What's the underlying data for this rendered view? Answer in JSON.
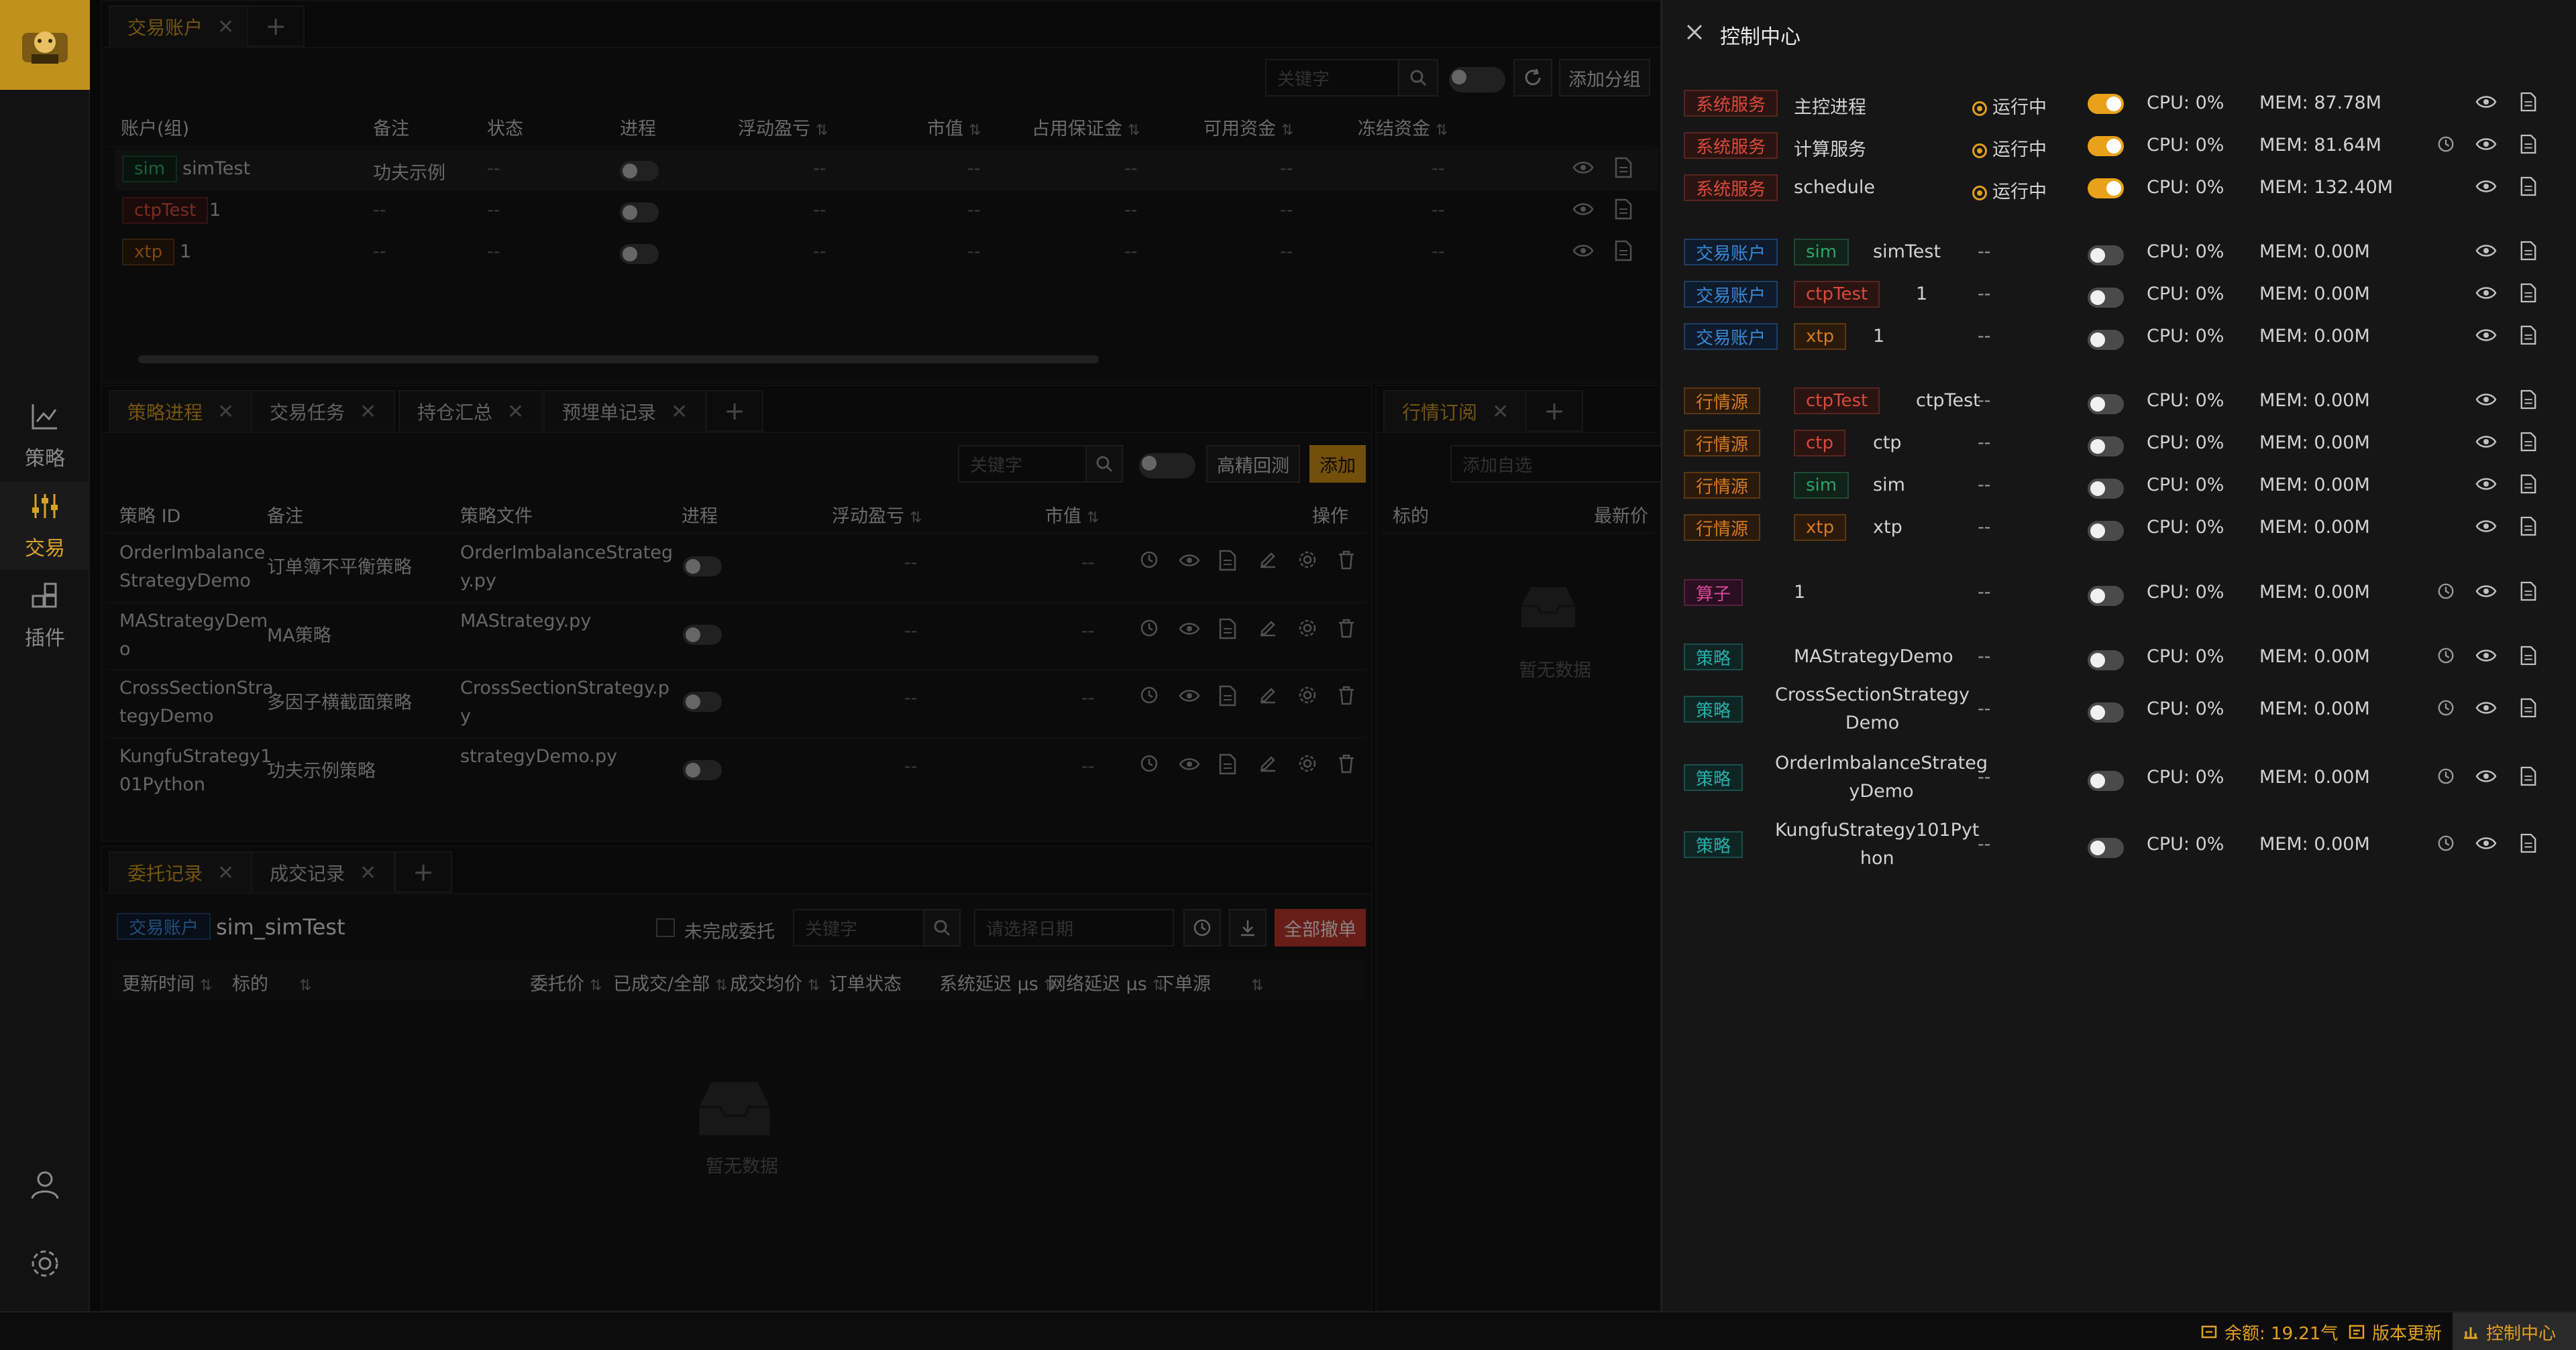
{
  "nav": {
    "items": [
      {
        "label": "策略",
        "icon": "chart-icon"
      },
      {
        "label": "交易",
        "icon": "sliders-icon"
      },
      {
        "label": "插件",
        "icon": "plugin-icon"
      }
    ]
  },
  "accounts": {
    "tabs": [
      {
        "label": "交易账户"
      }
    ],
    "search_placeholder": "关键字",
    "add_group_label": "添加分组",
    "headers": [
      "账户(组)",
      "备注",
      "状态",
      "进程",
      "浮动盈亏",
      "市值",
      "占用保证金",
      "可用资金",
      "冻结资金"
    ],
    "rows": [
      {
        "tag": "sim",
        "name": "simTest",
        "note": "功夫示例",
        "status": "--",
        "pnl": "--",
        "mv": "--",
        "margin": "--",
        "avail": "--",
        "frozen": "--"
      },
      {
        "tag": "ctpTest",
        "name": "1",
        "note": "--",
        "status": "--",
        "pnl": "--",
        "mv": "--",
        "margin": "--",
        "avail": "--",
        "frozen": "--"
      },
      {
        "tag": "xtp",
        "name": "1",
        "note": "--",
        "status": "--",
        "pnl": "--",
        "mv": "--",
        "margin": "--",
        "avail": "--",
        "frozen": "--"
      }
    ]
  },
  "strategy": {
    "tabs": [
      {
        "label": "策略进程"
      },
      {
        "label": "交易任务"
      },
      {
        "label": "持仓汇总"
      },
      {
        "label": "预埋单记录"
      }
    ],
    "search_placeholder": "关键字",
    "backtest_label": "高精回测",
    "add_label": "添加",
    "headers": [
      "策略 ID",
      "备注",
      "策略文件",
      "进程",
      "浮动盈亏",
      "市值",
      "操作"
    ],
    "rows": [
      {
        "id1": "OrderImbalance",
        "id2": "StrategyDemo",
        "note": "订单簿不平衡策略",
        "file1": "OrderImbalanceStrateg",
        "file2": "y.py",
        "pnl": "--",
        "mv": "--"
      },
      {
        "id1": "MAStrategyDem",
        "id2": "o",
        "note": "MA策略",
        "file1": "MAStrategy.py",
        "file2": "",
        "pnl": "--",
        "mv": "--"
      },
      {
        "id1": "CrossSectionStra",
        "id2": "tegyDemo",
        "note": "多因子横截面策略",
        "file1": "CrossSectionStrategy.p",
        "file2": "y",
        "pnl": "--",
        "mv": "--"
      },
      {
        "id1": "KungfuStrategy1",
        "id2": "01Python",
        "note": "功夫示例策略",
        "file1": "strategyDemo.py",
        "file2": "",
        "pnl": "--",
        "mv": "--"
      }
    ]
  },
  "market": {
    "tabs": [
      {
        "label": "行情订阅"
      }
    ],
    "add_placeholder": "添加自选",
    "headers": [
      "标的",
      "最新价"
    ],
    "empty": "暂无数据"
  },
  "orders": {
    "tabs": [
      {
        "label": "委托记录"
      },
      {
        "label": "成交记录"
      }
    ],
    "account_tag": "交易账户",
    "account_name": "sim_simTest",
    "unfinished_label": "未完成委托",
    "search_placeholder": "关键字",
    "date_placeholder": "请选择日期",
    "cancel_all_label": "全部撤单",
    "headers": [
      "更新时间",
      "标的",
      "委托价",
      "已成交/全部",
      "成交均价",
      "订单状态",
      "系统延迟 μs",
      "网络延迟 μs",
      "下单源"
    ],
    "empty": "暂无数据"
  },
  "control_center": {
    "title": "控制中心",
    "rows": [
      {
        "tag": "系统服务",
        "tag_color": "red",
        "name": "主控进程",
        "status": "运行中",
        "on": true,
        "cpu": "CPU: 0%",
        "mem": "MEM: 87.78M",
        "history": false
      },
      {
        "tag": "系统服务",
        "tag_color": "red",
        "name": "计算服务",
        "status": "运行中",
        "on": true,
        "cpu": "CPU: 0%",
        "mem": "MEM: 81.64M",
        "history": true
      },
      {
        "tag": "系统服务",
        "tag_color": "red",
        "name": "schedule",
        "status": "运行中",
        "on": true,
        "cpu": "CPU: 0%",
        "mem": "MEM: 132.40M",
        "history": false
      },
      {
        "tag": "交易账户",
        "tag_color": "blue",
        "sub": "sim",
        "sub_color": "green",
        "name": "simTest",
        "status": "--",
        "on": false,
        "cpu": "CPU: 0%",
        "mem": "MEM: 0.00M",
        "history": false
      },
      {
        "tag": "交易账户",
        "tag_color": "blue",
        "sub": "ctpTest",
        "sub_color": "red",
        "name": "1",
        "status": "--",
        "on": false,
        "cpu": "CPU: 0%",
        "mem": "MEM: 0.00M",
        "history": false
      },
      {
        "tag": "交易账户",
        "tag_color": "blue",
        "sub": "xtp",
        "sub_color": "orange",
        "name": "1",
        "status": "--",
        "on": false,
        "cpu": "CPU: 0%",
        "mem": "MEM: 0.00M",
        "history": false
      },
      {
        "tag": "行情源",
        "tag_color": "orange",
        "sub": "ctpTest",
        "sub_color": "red",
        "name": "ctpTest",
        "status": "--",
        "on": false,
        "cpu": "CPU: 0%",
        "mem": "MEM: 0.00M",
        "history": false
      },
      {
        "tag": "行情源",
        "tag_color": "orange",
        "sub": "ctp",
        "sub_color": "red",
        "name": "ctp",
        "status": "--",
        "on": false,
        "cpu": "CPU: 0%",
        "mem": "MEM: 0.00M",
        "history": false
      },
      {
        "tag": "行情源",
        "tag_color": "orange",
        "sub": "sim",
        "sub_color": "green",
        "name": "sim",
        "status": "--",
        "on": false,
        "cpu": "CPU: 0%",
        "mem": "MEM: 0.00M",
        "history": false
      },
      {
        "tag": "行情源",
        "tag_color": "orange",
        "sub": "xtp",
        "sub_color": "orange",
        "name": "xtp",
        "status": "--",
        "on": false,
        "cpu": "CPU: 0%",
        "mem": "MEM: 0.00M",
        "history": false
      },
      {
        "tag": "算子",
        "tag_color": "pink",
        "name": "1",
        "status": "--",
        "on": false,
        "cpu": "CPU: 0%",
        "mem": "MEM: 0.00M",
        "history": true
      },
      {
        "tag": "策略",
        "tag_color": "teal",
        "name": "MAStrategyDemo",
        "status": "--",
        "on": false,
        "cpu": "CPU: 0%",
        "mem": "MEM: 0.00M",
        "history": true
      },
      {
        "tag": "策略",
        "tag_color": "teal",
        "name": "CrossSectionStrategy",
        "name2": "Demo",
        "status": "--",
        "on": false,
        "cpu": "CPU: 0%",
        "mem": "MEM: 0.00M",
        "history": true
      },
      {
        "tag": "策略",
        "tag_color": "teal",
        "name": "OrderImbalanceStrateg",
        "name2": "yDemo",
        "status": "--",
        "on": false,
        "cpu": "CPU: 0%",
        "mem": "MEM: 0.00M",
        "history": true
      },
      {
        "tag": "策略",
        "tag_color": "teal",
        "name": "KungfuStrategy101Pyt",
        "name2": "hon",
        "status": "--",
        "on": false,
        "cpu": "CPU: 0%",
        "mem": "MEM: 0.00M",
        "history": true
      }
    ]
  },
  "statusbar": {
    "balance": "余额: 19.21气",
    "update": "版本更新",
    "control": "控制中心"
  }
}
